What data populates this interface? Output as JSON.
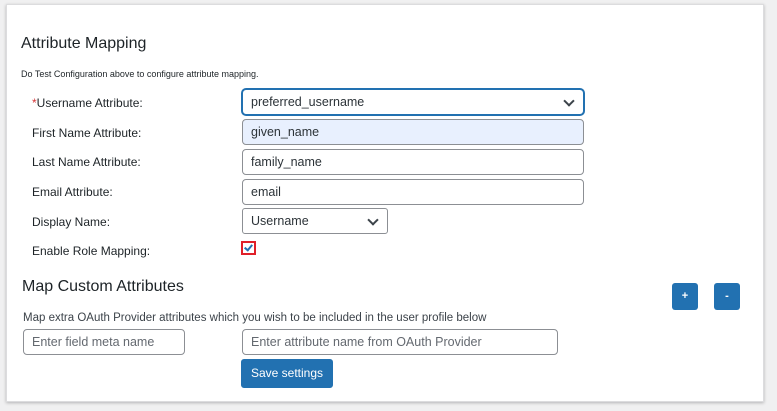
{
  "section": {
    "title": "Attribute Mapping",
    "hint": "Do Test Configuration above to configure attribute mapping."
  },
  "rows": {
    "username": {
      "required_mark": "*",
      "label": "Username Attribute:",
      "value": "preferred_username"
    },
    "first_name": {
      "label": "First Name Attribute:",
      "value": "given_name"
    },
    "last_name": {
      "label": "Last Name Attribute:",
      "value": "family_name"
    },
    "email": {
      "label": "Email Attribute:",
      "value": "email"
    },
    "display_name": {
      "label": "Display Name:",
      "value": "Username"
    },
    "role_mapping": {
      "label": "Enable Role Mapping:",
      "checked": true
    }
  },
  "custom": {
    "title": "Map Custom Attributes",
    "add_label": "+",
    "remove_label": "-",
    "hint": "Map extra OAuth Provider attributes which you wish to be included in the user profile below",
    "meta_placeholder": "Enter field meta name",
    "attr_placeholder": "Enter attribute name from OAuth Provider"
  },
  "actions": {
    "save_label": "Save settings"
  },
  "colors": {
    "primary": "#2271b1",
    "required": "#d63638",
    "highlight_border": "#e0202a",
    "autofill_bg": "#e8f0fe"
  },
  "icons": {
    "dropdown": "chevron-down-icon",
    "checkbox": "checkmark-icon"
  }
}
